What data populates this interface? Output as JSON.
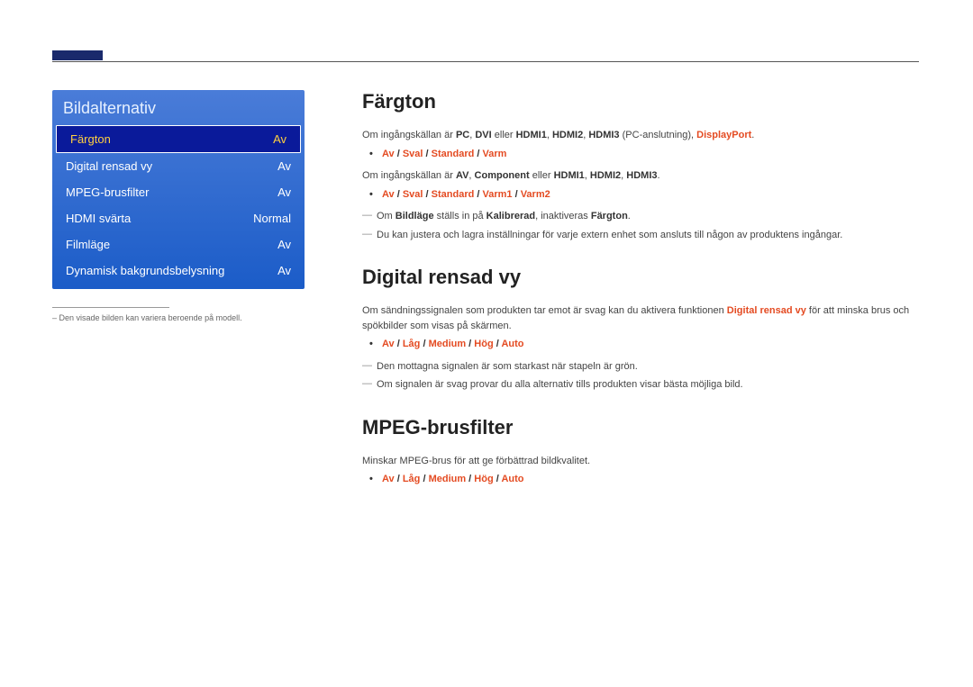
{
  "menu": {
    "title": "Bildalternativ",
    "items": [
      {
        "label": "Färgton",
        "value": "Av"
      },
      {
        "label": "Digital rensad vy",
        "value": "Av"
      },
      {
        "label": "MPEG-brusfilter",
        "value": "Av"
      },
      {
        "label": "HDMI svärta",
        "value": "Normal"
      },
      {
        "label": "Filmläge",
        "value": "Av"
      },
      {
        "label": "Dynamisk bakgrundsbelysning",
        "value": "Av"
      }
    ],
    "footnote": "Den visade bilden kan variera beroende på modell."
  },
  "fargton": {
    "heading": "Färgton",
    "line1_pre": "Om ingångskällan är ",
    "line1_pc": "PC",
    "line1_c1": ", ",
    "line1_dvi": "DVI",
    "line1_mid": " eller ",
    "line1_h1": "HDMI1",
    "line1_c2": ", ",
    "line1_h2": "HDMI2",
    "line1_c3": ", ",
    "line1_h3": "HDMI3",
    "line1_post": " (PC-anslutning), ",
    "line1_dp": "DisplayPort",
    "line1_dot": ".",
    "opt1_av": "Av",
    "opt1_sval": "Sval",
    "opt1_std": "Standard",
    "opt1_varm": "Varm",
    "line2_pre": "Om ingångskällan är ",
    "line2_av": "AV",
    "line2_c1": ", ",
    "line2_comp": "Component",
    "line2_mid": " eller ",
    "line2_h1": "HDMI1",
    "line2_c2": ", ",
    "line2_h2": "HDMI2",
    "line2_c3": ", ",
    "line2_h3": "HDMI3",
    "line2_dot": ".",
    "opt2_av": "Av",
    "opt2_sval": "Sval",
    "opt2_std": "Standard",
    "opt2_v1": "Varm1",
    "opt2_v2": "Varm2",
    "note1_pre": "Om ",
    "note1_bild": "Bildläge",
    "note1_mid": " ställs in på ",
    "note1_kal": "Kalibrerad",
    "note1_post": ", inaktiveras ",
    "note1_farg": "Färgton",
    "note1_dot": ".",
    "note2": "Du kan justera och lagra inställningar för varje extern enhet som ansluts till någon av produktens ingångar."
  },
  "drv": {
    "heading": "Digital rensad vy",
    "desc_pre": "Om sändningssignalen som produkten tar emot är svag kan du aktivera funktionen ",
    "desc_term": "Digital rensad vy",
    "desc_post": " för att minska brus och spökbilder som visas på skärmen.",
    "opt_av": "Av",
    "opt_lag": "Låg",
    "opt_med": "Medium",
    "opt_hog": "Hög",
    "opt_auto": "Auto",
    "note1": "Den mottagna signalen är som starkast när stapeln är grön.",
    "note2": "Om signalen är svag provar du alla alternativ tills produkten visar bästa möjliga bild."
  },
  "mpeg": {
    "heading": "MPEG-brusfilter",
    "desc": "Minskar MPEG-brus för att ge förbättrad bildkvalitet.",
    "opt_av": "Av",
    "opt_lag": "Låg",
    "opt_med": "Medium",
    "opt_hog": "Hög",
    "opt_auto": "Auto"
  },
  "slash": " / "
}
